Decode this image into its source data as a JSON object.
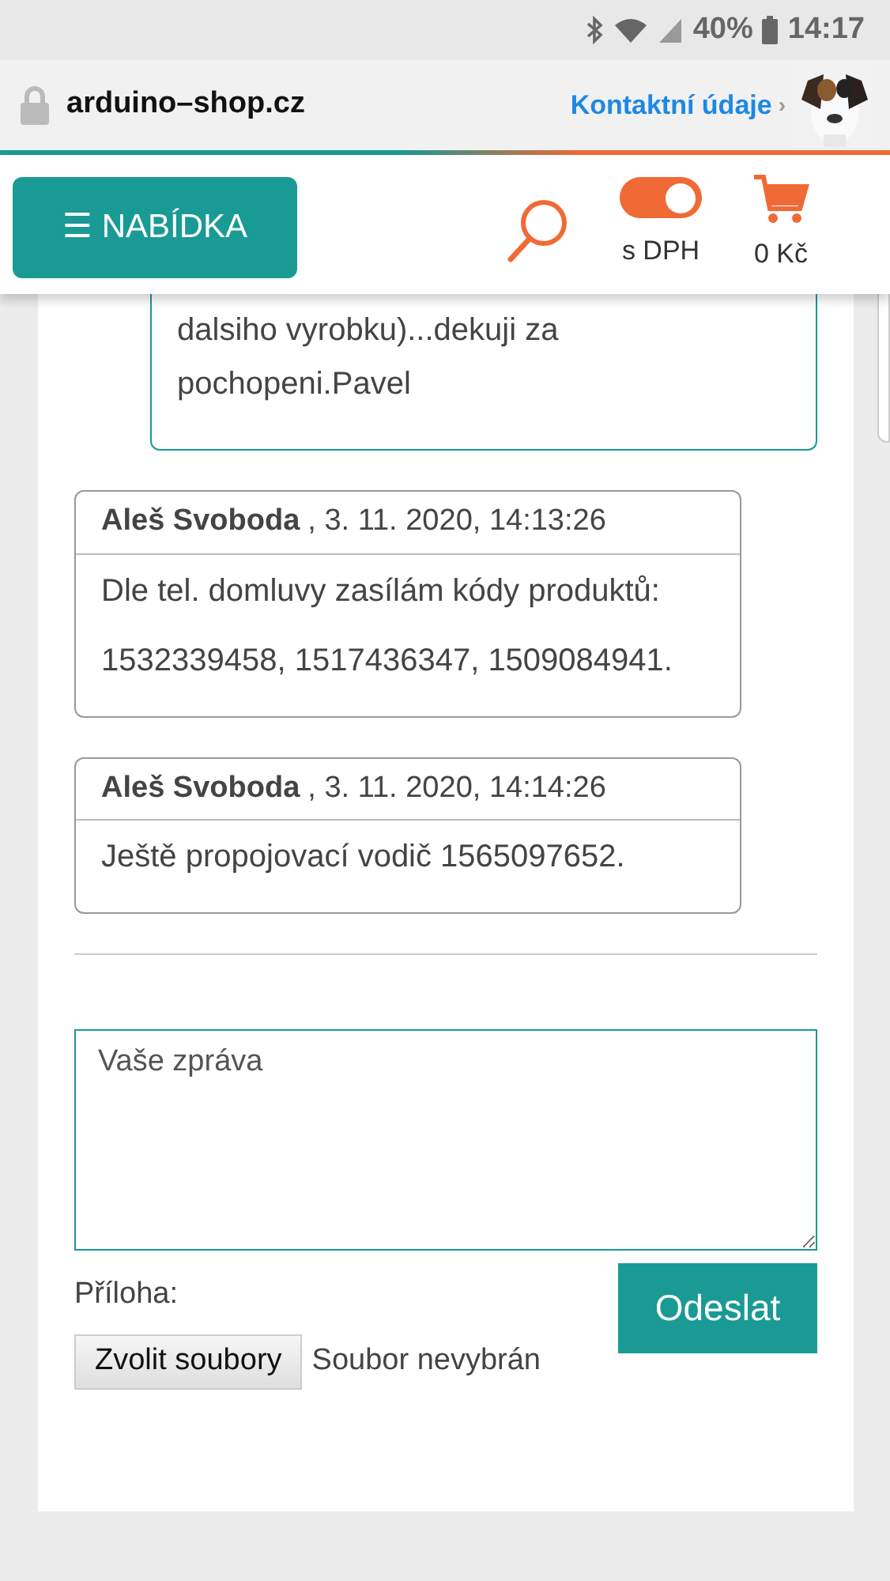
{
  "status_bar": {
    "battery": "40%",
    "time": "14:17"
  },
  "address_bar": {
    "domain": "arduino–shop.cz",
    "contact_link": "Kontaktní údaje",
    "chevron": "›"
  },
  "header": {
    "menu_button": "☰ NABÍDKA",
    "vat_toggle": {
      "label": "s DPH",
      "on": true
    },
    "cart": {
      "total": "0 Kč"
    }
  },
  "messages": [
    {
      "kind": "reply",
      "lines": [
        "dalsiho vyrobku)...dekuji za pochopeni.Pavel"
      ]
    },
    {
      "kind": "comment",
      "author": "Aleš Svoboda",
      "date": ", 3. 11. 2020, 14:13:26",
      "lines": [
        "Dle tel. domluvy zasílám kódy produktů:",
        "1532339458, 1517436347, 1509084941."
      ]
    },
    {
      "kind": "comment",
      "author": "Aleš Svoboda",
      "date": ", 3. 11. 2020, 14:14:26",
      "lines": [
        "Ještě propojovací vodič 1565097652."
      ]
    }
  ],
  "form": {
    "message_placeholder": "Vaše zpráva",
    "attachment_label": "Příloha:",
    "file_button": "Zvolit soubory",
    "file_status": "Soubor nevybrán",
    "submit": "Odeslat"
  }
}
